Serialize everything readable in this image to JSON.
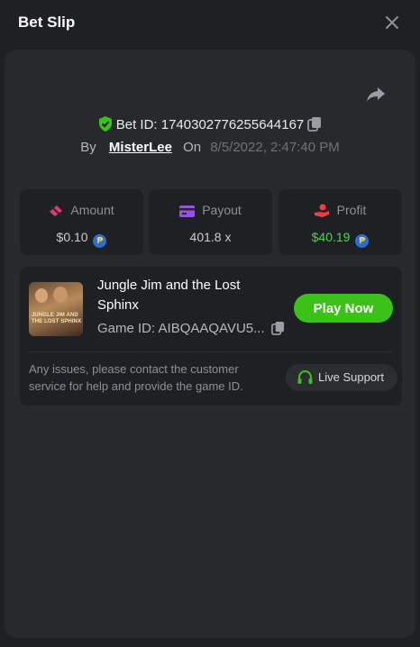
{
  "header": {
    "title": "Bet Slip"
  },
  "bet": {
    "id_label": "Bet ID: 174030277625564416​7",
    "by_label": "By",
    "user": "MisterLee",
    "on_label": "On",
    "date": "8/5/2022, 2:47:40 PM"
  },
  "stats": {
    "amount": {
      "label": "Amount",
      "value": "$0.10",
      "icon": "money-off-icon",
      "icon_color": "#e0387a"
    },
    "payout": {
      "label": "Payout",
      "value": "401.8 x",
      "icon": "card-icon",
      "icon_color": "#9a4ef2"
    },
    "profit": {
      "label": "Profit",
      "value": "$40.19",
      "icon": "hand-coin-icon",
      "icon_color": "#ff3b3b"
    }
  },
  "currency_symbol": "₱",
  "game": {
    "name": "Jungle Jim and the Lost Sphinx",
    "thumb_text": "JUNGLE JIM AND THE LOST SPHINX",
    "id_label": "Game ID: AIBQAAQAVU5...",
    "play_label": "Play Now"
  },
  "support": {
    "issue_text": "Any issues, please contact the customer service for help and provide the game ID.",
    "button_label": "Live Support"
  },
  "colors": {
    "accent": "#3bc117",
    "profit": "#4bd34b",
    "verified": "#3bc117"
  }
}
